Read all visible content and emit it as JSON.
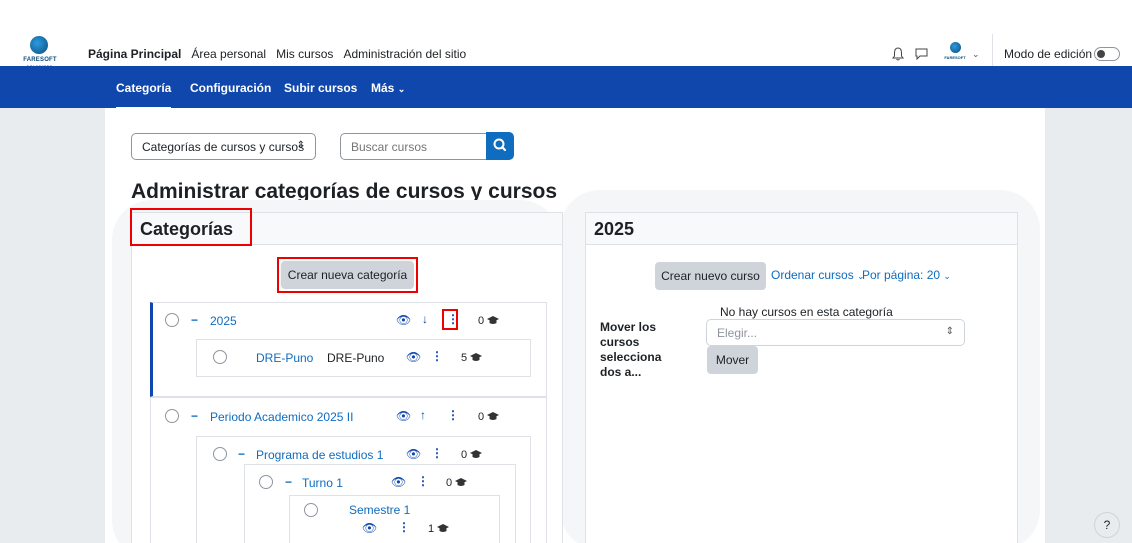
{
  "branding": {
    "logo_text": "FARESOFT",
    "logo_sub": "SOLUTIONS",
    "avatar_text": "FARESOFT"
  },
  "topnav": {
    "items": [
      "Página Principal",
      "Área personal",
      "Mis cursos",
      "Administración del sitio"
    ],
    "edit_mode_label": "Modo de edición",
    "edit_mode_on": false
  },
  "secondary_nav": {
    "tabs": [
      "Categoría",
      "Configuración",
      "Subir cursos",
      "Más"
    ]
  },
  "filters": {
    "view_select": "Categorías de cursos y cursos",
    "search_placeholder": "Buscar cursos"
  },
  "page_title": "Administrar categorías de cursos y cursos",
  "categories_panel": {
    "heading": "Categorías",
    "create_button": "Crear nueva categoría",
    "tree": [
      {
        "name": "2025",
        "count": "0"
      },
      {
        "name": "DRE-Puno",
        "idnumber": "DRE-Puno",
        "count": "5"
      },
      {
        "name": "Periodo Academico 2025 II",
        "count": "0"
      },
      {
        "name": "Programa de estudios 1",
        "count": "0"
      },
      {
        "name": "Turno 1",
        "count": "0"
      },
      {
        "name": "Semestre 1",
        "count": "1"
      }
    ]
  },
  "courses_panel": {
    "heading": "2025",
    "create_course_button": "Crear nuevo curso",
    "sort_link": "Ordenar cursos",
    "per_page_link": "Por página: 20",
    "empty_message": "No hay cursos en esta categoría",
    "move_label": "Mover los cursos selecciona dos a...",
    "move_select_placeholder": "Elegir...",
    "move_button": "Mover"
  },
  "help_button": "?",
  "colors": {
    "nav_blue": "#0f47ad",
    "link_blue": "#0f6cbf",
    "highlight_red": "#e00000"
  }
}
